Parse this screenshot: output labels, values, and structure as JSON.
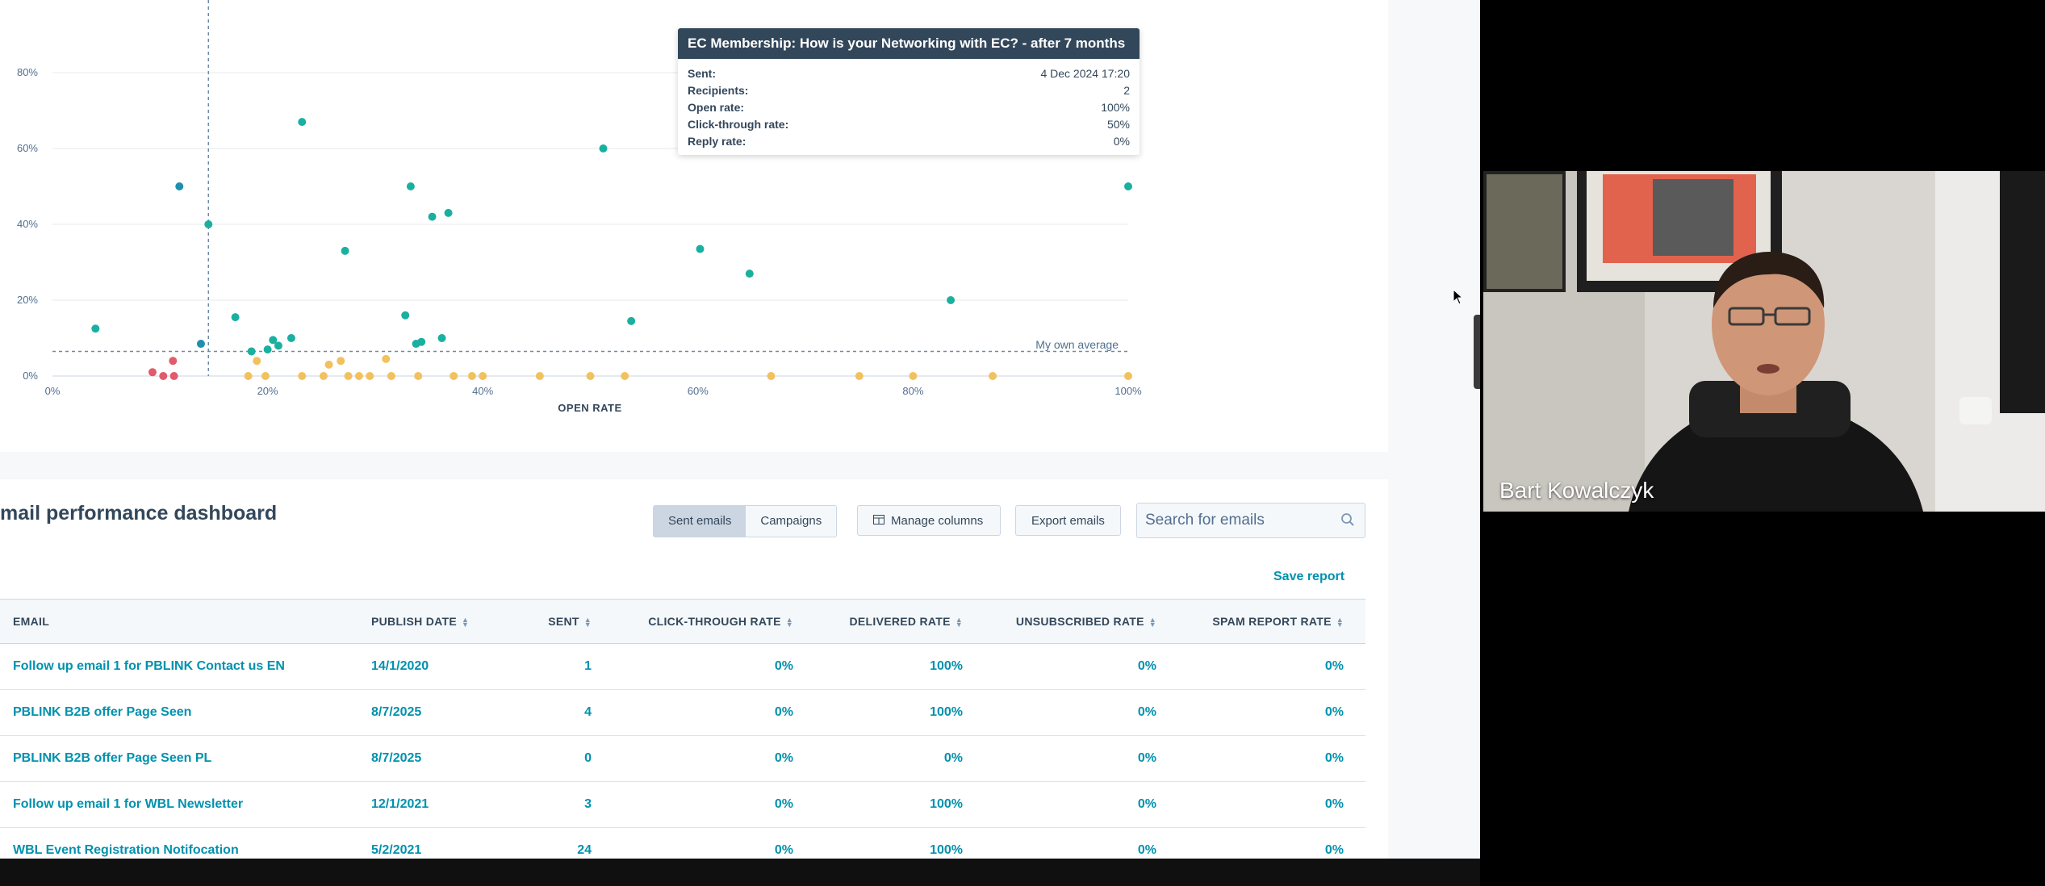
{
  "chart": {
    "x_axis_title": "OPEN RATE",
    "average_label": "My own average",
    "x_ticks": [
      "0%",
      "20%",
      "40%",
      "60%",
      "80%",
      "100%"
    ],
    "y_ticks": [
      "0%",
      "20%",
      "40%",
      "60%",
      "80%"
    ]
  },
  "chart_data": {
    "type": "scatter",
    "xlabel": "OPEN RATE",
    "ylabel": "",
    "xlim": [
      0,
      1
    ],
    "ylim": [
      0,
      0.85
    ],
    "x_ticks": [
      "0%",
      "20%",
      "40%",
      "60%",
      "80%",
      "100%"
    ],
    "y_ticks": [
      "0%",
      "20%",
      "40%",
      "60%",
      "80%"
    ],
    "reference_lines": {
      "average_open_rate": 0.145,
      "average_click_rate": 0.065
    },
    "colors": {
      "teal": "#1ab0a0",
      "blue": "#1f8fb0",
      "yellow": "#f2c15e",
      "red": "#e35a6a"
    },
    "series": [
      {
        "color": "teal",
        "points": [
          [
            0.04,
            0.125
          ],
          [
            0.145,
            0.4
          ],
          [
            0.17,
            0.155
          ],
          [
            0.185,
            0.065
          ],
          [
            0.2,
            0.07
          ],
          [
            0.205,
            0.095
          ],
          [
            0.21,
            0.08
          ],
          [
            0.222,
            0.1
          ],
          [
            0.232,
            0.67
          ],
          [
            0.272,
            0.33
          ],
          [
            0.328,
            0.16
          ],
          [
            0.333,
            0.5
          ],
          [
            0.338,
            0.085
          ],
          [
            0.343,
            0.09
          ],
          [
            0.353,
            0.42
          ],
          [
            0.362,
            0.1
          ],
          [
            0.368,
            0.43
          ],
          [
            0.512,
            0.6
          ],
          [
            0.538,
            0.145
          ],
          [
            0.602,
            0.335
          ],
          [
            0.648,
            0.27
          ],
          [
            0.835,
            0.2
          ],
          [
            1.0,
            0.5
          ]
        ]
      },
      {
        "color": "blue",
        "points": [
          [
            0.118,
            0.5
          ],
          [
            0.138,
            0.085
          ]
        ]
      },
      {
        "color": "yellow",
        "points": [
          [
            0.182,
            0
          ],
          [
            0.19,
            0.04
          ],
          [
            0.198,
            0
          ],
          [
            0.232,
            0
          ],
          [
            0.252,
            0
          ],
          [
            0.257,
            0.03
          ],
          [
            0.268,
            0.04
          ],
          [
            0.275,
            0
          ],
          [
            0.285,
            0
          ],
          [
            0.295,
            0
          ],
          [
            0.315,
            0
          ],
          [
            0.31,
            0.045
          ],
          [
            0.34,
            0
          ],
          [
            0.373,
            0
          ],
          [
            0.39,
            0
          ],
          [
            0.4,
            0
          ],
          [
            0.453,
            0
          ],
          [
            0.5,
            0
          ],
          [
            0.532,
            0
          ],
          [
            0.668,
            0
          ],
          [
            0.75,
            0
          ],
          [
            0.8,
            0
          ],
          [
            0.874,
            0
          ],
          [
            1.0,
            0
          ]
        ]
      },
      {
        "color": "red",
        "points": [
          [
            0.093,
            0.01
          ],
          [
            0.103,
            0
          ],
          [
            0.113,
            0
          ],
          [
            0.112,
            0.04
          ]
        ]
      }
    ]
  },
  "tooltip": {
    "title": "EC Membership: How is your Networking with EC? - after 7 months",
    "rows": [
      {
        "label": "Sent:",
        "value": "4 Dec 2024 17:20"
      },
      {
        "label": "Recipients:",
        "value": "2"
      },
      {
        "label": "Open rate:",
        "value": "100%"
      },
      {
        "label": "Click-through rate:",
        "value": "50%"
      },
      {
        "label": "Reply rate:",
        "value": "0%"
      }
    ]
  },
  "dashboard": {
    "title": "mail performance dashboard",
    "seg_sent": "Sent emails",
    "seg_campaigns": "Campaigns",
    "manage_columns": "Manage columns",
    "export_emails": "Export emails",
    "search_placeholder": "Search for emails",
    "save_report": "Save report"
  },
  "table": {
    "headers": [
      "EMAIL",
      "PUBLISH DATE",
      "SENT",
      "CLICK-THROUGH RATE",
      "DELIVERED RATE",
      "UNSUBSCRIBED RATE",
      "SPAM REPORT RATE"
    ],
    "rows": [
      [
        "Follow up email 1 for PBLINK Contact us EN",
        "14/1/2020",
        "1",
        "0%",
        "100%",
        "0%",
        "0%"
      ],
      [
        "PBLINK B2B offer Page Seen",
        "8/7/2025",
        "4",
        "0%",
        "100%",
        "0%",
        "0%"
      ],
      [
        "PBLINK B2B offer Page Seen PL",
        "8/7/2025",
        "0",
        "0%",
        "0%",
        "0%",
        "0%"
      ],
      [
        "Follow up email 1 for WBL Newsletter",
        "12/1/2021",
        "3",
        "0%",
        "100%",
        "0%",
        "0%"
      ],
      [
        "WBL Event Registration Notifocation",
        "5/2/2021",
        "24",
        "0%",
        "100%",
        "0%",
        "0%"
      ]
    ]
  },
  "video": {
    "participant_name": "Bart Kowalczyk"
  }
}
